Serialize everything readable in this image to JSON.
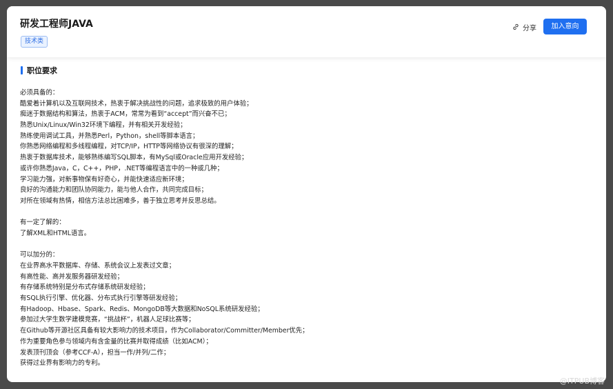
{
  "header": {
    "job_title": "研发工程师JAVA",
    "category_tag": "技术类",
    "share_label": "分享",
    "join_label": "加入意向"
  },
  "section": {
    "title": "职位要求"
  },
  "requirements": [
    "必须具备的：",
    "酷爱着计算机以及互联网技术，热衷于解决挑战性的问题，追求极致的用户体验；",
    "痴迷于数据结构和算法，热衷于ACM，常常为看到“accept”而兴奋不已；",
    "熟悉Unix/Linux/Win32环境下编程，并有相关开发经验；",
    "熟练使用调试工具，并熟悉Perl，Python，shell等脚本语言；",
    "你熟悉网络编程和多线程编程，对TCP/IP，HTTP等网络协议有很深的理解；",
    "热衷于数据库技术，能够熟练编写SQL脚本，有MySql或Oracle应用开发经验；",
    "或许你熟悉Java，C，C++，PHP，.NET等编程语言中的一种或几种；",
    "学习能力强，对新事物保有好奇心，并能快速适应新环境；",
    "良好的沟通能力和团队协同能力，能与他人合作，共同完成目标；",
    "对所在领域有热情，相信方法总比困难多，善于独立思考并反思总结。",
    "",
    "有一定了解的：",
    "了解XML和HTML语言。",
    "",
    "可以加分的：",
    "在业界高水平数据库、存储、系统会议上发表过文章；",
    "有高性能、高并发服务器研发经验；",
    "有存储系统特别是分布式存储系统研发经验；",
    "有SQL执行引擎、优化器、分布式执行引擎等研发经验；",
    "有Hadoop、Hbase、Spark、Redis、MongoDB等大数据和NoSQL系统研发经验；",
    "参加过大学生数学建模竞赛，“挑战杯”，机器人足球比赛等；",
    "在Github等开源社区具备有较大影响力的技术项目，作为Collaborator/Committer/Member优先；",
    "作为重要角色参与领域内有含金量的比赛并取得成绩（比如ACM）；",
    "发表顶刊顶会（参考CCF-A），担当一作/并列/二作；",
    "获得过业界有影响力的专利。"
  ],
  "watermark": "@ITPUB博客",
  "colors": {
    "accent": "#1f6ff0",
    "tag_bg": "#eaf2ff",
    "tag_text": "#2f6fe4"
  },
  "icons": {
    "share": "link-icon"
  }
}
